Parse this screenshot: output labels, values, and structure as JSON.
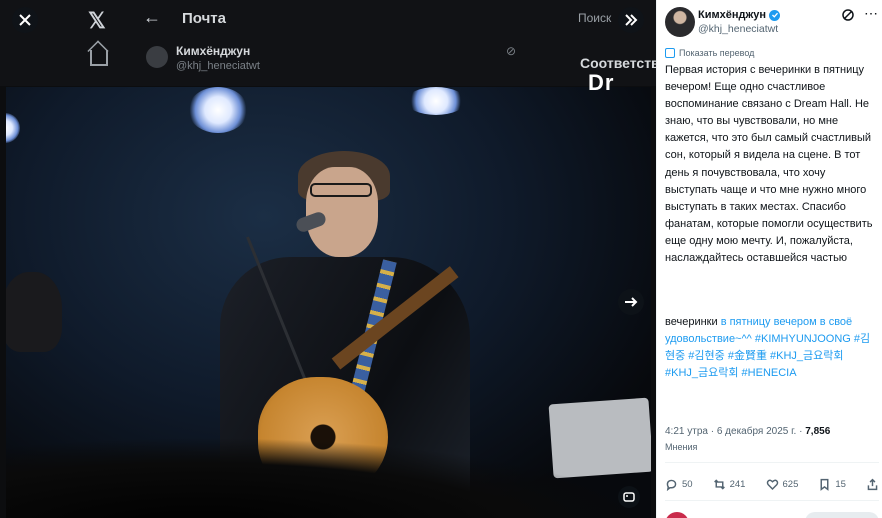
{
  "background": {
    "nav_title": "Почта",
    "profile_name": "Кимхёнджун",
    "profile_handle": "@khj_heneciatwt",
    "search_placeholder": "Поиск",
    "subscribe_label": "Соответств"
  },
  "viewer": {
    "close_icon": "close-icon",
    "expand_icon": "chevrons-right-icon",
    "next_icon": "arrow-right-icon",
    "alt_icon": "image-alt-icon",
    "stage_logo": "Dr"
  },
  "tweet": {
    "author_name": "Кимхёнджун",
    "author_handle": "@khj_heneciatwt",
    "translate_link": "Показать перевод",
    "body": "Первая история с вечеринки в пятницу вечером! Еще одно счастливое воспоминание связано с Dream Hall. Не знаю, что вы чувствовали, но мне кажется, что это был самый счастливый сон, который я видела на сцене. В тот день я почувствовала, что хочу выступать чаще и что мне нужно много выступать в таких местах. Спасибо фанатам, которые помогли осуществить еще одну мою мечту. И, пожалуйста, наслаждайтесь оставшейся частью",
    "hashtags_prefix": "вечеринки",
    "hashtags_links": "в пятницу вечером в своё удовольствие~^^ #KIMHYUNJOONG #김현중 #김현중 #金賢重 #KHJ_금요락회 #KHJ_금요락회 #HENECIA",
    "time": "4:21 утра",
    "date": "6 декабря 2025 г.",
    "views": "7,856",
    "views_label": "Мнения",
    "replies": "50",
    "retweets": "241",
    "likes": "625",
    "bookmarks": "15"
  }
}
